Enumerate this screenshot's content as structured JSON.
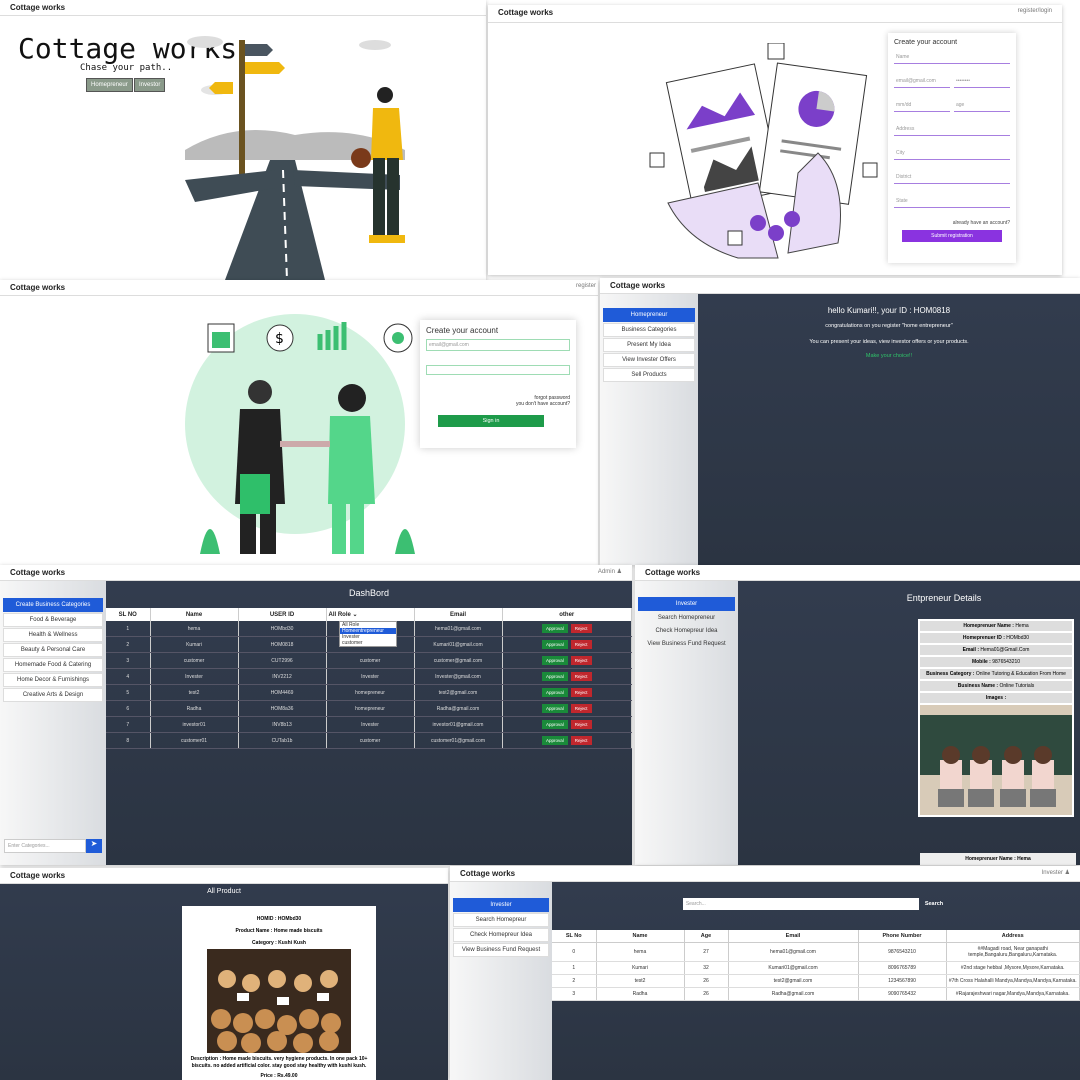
{
  "brand": "Cottage works",
  "landing": {
    "title": "Cottage works",
    "tagline": "Chase your path..",
    "btn1": "Homepreneur",
    "btn2": "Investor"
  },
  "register": {
    "nav_right": "register/login",
    "heading": "Create your account",
    "fields": [
      "Name",
      "email@gmail.com",
      "Mobile",
      "Address",
      "City",
      "District",
      "State"
    ],
    "pw": "••••••••",
    "dob": "mm/dd",
    "age": "age",
    "already": "already have an account?",
    "submit": "Submit registration"
  },
  "login": {
    "nav_right": "register",
    "heading": "Create your account",
    "email": "email@gmail.com",
    "forgot": "forgot password",
    "noacc": "you don't have account?",
    "signin": "Sign in"
  },
  "welcome": {
    "side": [
      "Homepreneur",
      "Business Categories",
      "Present My Idea",
      "View Invester Offers",
      "Sell Products"
    ],
    "hello": "hello Kumari!!, your ID : HOM0818",
    "congrats": "congratulations on you register \"home entrepreneur\"",
    "present": "You can present your ideas, view investor offers or your products.",
    "choice": "Make your choice!!"
  },
  "dashboard": {
    "admin": "Admin",
    "title": "DashBord",
    "side": [
      "Create Business Categories",
      "Food & Beverage",
      "Health & Wellness",
      "Beauty & Personal Care",
      "Homemade Food & Catering",
      "Home Decor & Furnishings",
      "Creative Arts & Design"
    ],
    "search_placeholder": "Enter Categories...",
    "headers": [
      "SL NO",
      "Name",
      "USER ID",
      "All Role",
      "Email",
      "other"
    ],
    "dropdown": [
      "All Role",
      "Homeentrepreneur",
      "Invester",
      "customer"
    ],
    "approve": "Approval",
    "reject": "Reject",
    "rows": [
      [
        "1",
        "hema",
        "HOMbd30",
        "",
        "hema01@gmail.com"
      ],
      [
        "2",
        "Kumari",
        "HOM0818",
        "",
        "Kumari01@gmail.com"
      ],
      [
        "3",
        "customer",
        "CUT2996",
        "customer",
        "customer@gmail.com"
      ],
      [
        "4",
        "Invester",
        "INV2212",
        "Invester",
        "Invester@gmail.com"
      ],
      [
        "5",
        "test2",
        "HOM4469",
        "homepreneur",
        "test2@gmail.com"
      ],
      [
        "6",
        "Radha",
        "HOM8a36",
        "homepreneur",
        "Radha@gmail.com"
      ],
      [
        "7",
        "investor01",
        "INV8b13",
        "Invester",
        "investor01@gmail.com"
      ],
      [
        "8",
        "customer01",
        "CUTab1b",
        "customer",
        "customer01@gmail.com"
      ]
    ]
  },
  "entrepreneur": {
    "side": [
      "Invester",
      "Search Homepreneur",
      "Check Homepreur Idea",
      "View Business Fund Request"
    ],
    "title": "Entpreneur Details",
    "rows": [
      [
        "Homeprenuer Name :",
        "Hema"
      ],
      [
        "Homeprenuer ID :",
        "HOMbd30"
      ],
      [
        "Email :",
        "Hema01@Gmail.Com"
      ],
      [
        "Mobile :",
        "9876543210"
      ],
      [
        "Business Category :",
        "Online Tutoring & Education From Home"
      ],
      [
        "Business Name :",
        "Online Tutorials"
      ],
      [
        "Images :",
        ""
      ]
    ],
    "footer": "Homeprenuer Name : Hema"
  },
  "product": {
    "title": "All Product",
    "homeid": "HOMID : HOMbd30",
    "name": "Product Name : Home made biscuits",
    "category": "Category : Kushi Kush",
    "desc": "Description : Home made biscuits. very hygiene products. In one pack 10+ biscuits. no added artificial color. stay good stay healthy with kushi kush.",
    "price": "Price : Rs.49.00"
  },
  "investor_list": {
    "user": "Invester",
    "side": [
      "Invester",
      "Search Homepreur",
      "Check Homepreur Idea",
      "View Business Fund Request"
    ],
    "search": "Search...",
    "search_btn": "Search",
    "headers": [
      "SL No",
      "Name",
      "Age",
      "Email",
      "Phone Number",
      "Address"
    ],
    "rows": [
      [
        "0",
        "hema",
        "27",
        "hema01@gmail.com",
        "9876543210",
        "##Magadi road, Near ganapathi temple,Bangaluru,Bangaluru,Karnataka."
      ],
      [
        "1",
        "Kumari",
        "32",
        "Kumari01@gmail.com",
        "8096765789",
        "#2nd stage hebbal ,Mysore,Mysore,Karnataka."
      ],
      [
        "2",
        "test2",
        "26",
        "test2@gmail.com",
        "1234567890",
        "#7th Cross Halahalli Mandya,Mandya,Mandya,Karnataka."
      ],
      [
        "3",
        "Radha",
        "26",
        "Radha@gmail.com",
        "9090765432",
        "#Rajarajeshwari nagar,Mandya,Mandya,Karnataka."
      ]
    ]
  }
}
